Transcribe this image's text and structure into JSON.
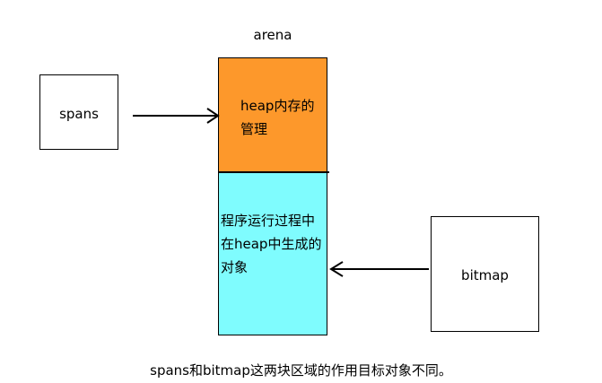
{
  "diagram": {
    "arena_label": "arena",
    "heap_management": "heap内存的管理",
    "heap_objects": "程序运行过程中在heap中生成的对象",
    "spans_label": "spans",
    "bitmap_label": "bitmap",
    "caption": "spans和bitmap这两块区域的作用目标对象不同。"
  },
  "colors": {
    "heap_management_fill": "#fd982b",
    "heap_objects_fill": "#7ffcfe",
    "stroke": "#000000"
  }
}
